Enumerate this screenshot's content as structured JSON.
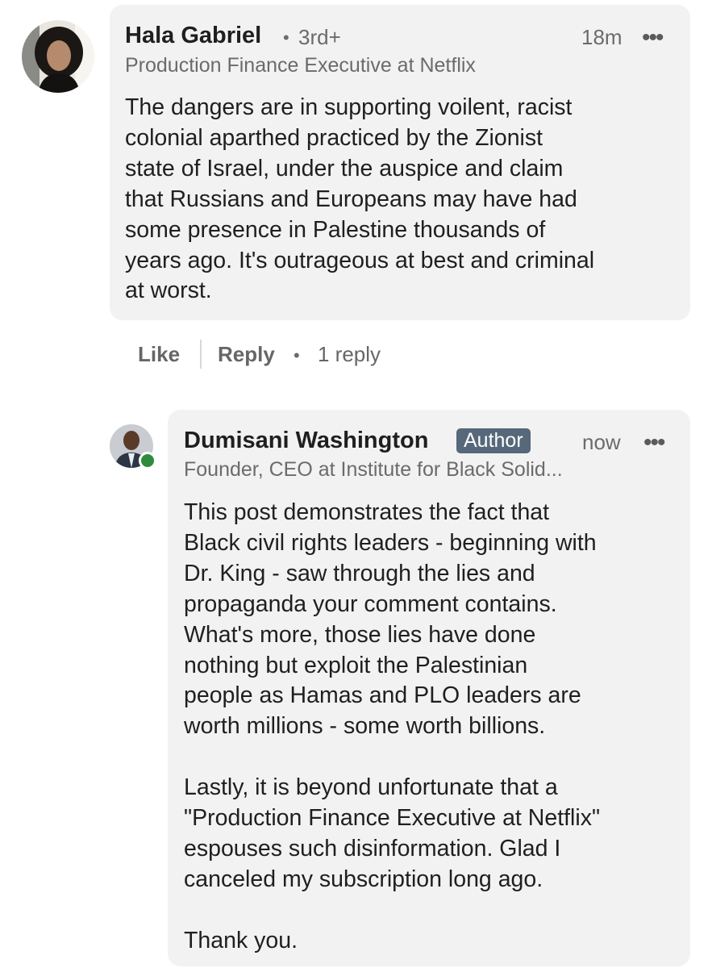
{
  "comment": {
    "author_name": "Hala Gabriel",
    "degree": "3rd+",
    "time": "18m",
    "more_icon": "•••",
    "headline": "Production Finance Executive at Netflix",
    "text": "The dangers are in supporting voilent, racist\ncolonial aparthed practiced by the Zionist\nstate of Israel, under the auspice and claim\nthat Russians and Europeans may have had\nsome presence in Palestine thousands of\nyears ago. It's outrageous at best and criminal\nat worst.",
    "actions": {
      "like": "Like",
      "reply": "Reply",
      "reply_count": "1 reply"
    }
  },
  "reply": {
    "author_name": "Dumisani Washington",
    "badge": "Author",
    "time": "now",
    "more_icon": "•••",
    "headline": "Founder, CEO at Institute for Black Solid...",
    "text": "This post demonstrates the fact that\nBlack civil rights leaders - beginning with\nDr. King - saw through the lies and\npropaganda your comment contains.\nWhat's more, those lies have done\nnothing but exploit the Palestinian\npeople as Hamas and PLO leaders are\nworth millions - some worth billions.\n\nLastly, it is beyond unfortunate that a\n\"Production Finance Executive at Netflix\"\nespouses such disinformation. Glad I\ncanceled my subscription long ago.\n\nThank you."
  },
  "colors": {
    "bubble_bg": "#f2f2f2",
    "badge_bg": "#56687a",
    "online_green": "#2e8b3e",
    "muted_text": "#6b6b6b"
  }
}
